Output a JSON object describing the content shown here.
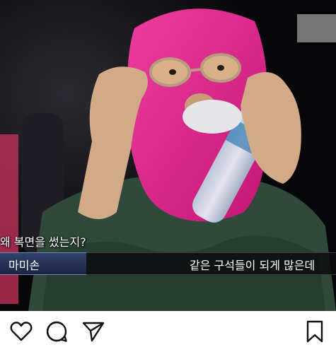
{
  "post": {
    "caption_line1": "왜 복면을 썼는지?",
    "name_tag": "마미손",
    "subtitle": "같은 구석들이 되게 많은데"
  },
  "actions": {
    "icons": [
      "heart-icon",
      "comment-icon",
      "share-icon",
      "bookmark-icon"
    ]
  },
  "colors": {
    "mask": "#e0278e",
    "name_bar": "#26335a",
    "background": "#0b0b0e"
  }
}
